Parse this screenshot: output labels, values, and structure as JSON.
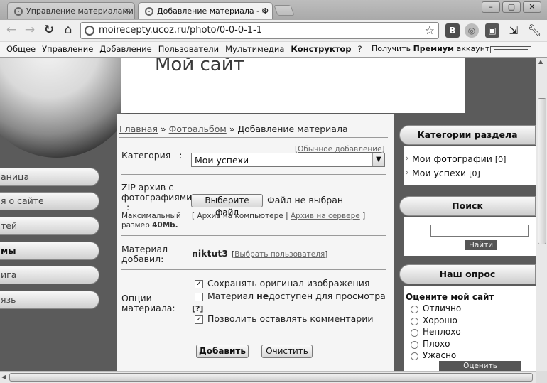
{
  "browser": {
    "tabs": [
      {
        "label": "Управление материалами"
      },
      {
        "label": "Добавление материала - Ф"
      }
    ],
    "tab_close_glyph": "×",
    "window_buttons": [
      "–",
      "▢",
      "✕"
    ],
    "url": "moirecepty.ucoz.ru/photo/0-0-0-1-1",
    "extensions": {
      "vk": "B"
    }
  },
  "adminbar": {
    "menu": [
      "Общее",
      "Управление",
      "Добавление",
      "Пользователи",
      "Мультимедиа",
      "Конструктор",
      "?"
    ],
    "premium_prefix": "Получить",
    "premium_bold": "Премиум",
    "premium_suffix": "аккаунт"
  },
  "site": {
    "title": "Мой сайт"
  },
  "left_nav": [
    "аница",
    "я о сайте",
    "тей",
    "мы",
    "ига",
    "язь"
  ],
  "breadcrumb": {
    "home": "Главная",
    "sep": "»",
    "album": "Фотоальбом",
    "current": "Добавление материала"
  },
  "form": {
    "normal_add_link": "Обычное добавление",
    "category_label": "Категория",
    "category_colon": ":",
    "category_value": "Мои успехи",
    "zip_label_1": "ZIP архив с",
    "zip_label_2": "фотографиями",
    "zip_label_3": ":",
    "choose_file_button": "Выберите файл",
    "file_status": "Файл не выбран",
    "max_size_1": "Максимальный",
    "max_size_2": "размер",
    "max_size_value": "40Mb.",
    "archive_on_computer": "Архив на компьютере",
    "archive_on_server": "Архив на сервере",
    "added_by_label_1": "Материал",
    "added_by_label_2": "добавил:",
    "added_by_value": "niktut3",
    "choose_user_link": "Выбрать пользователя",
    "options_label_1": "Опции",
    "options_label_2": "материала:",
    "opt_keep_original": "Сохранять оригинал изображения",
    "opt_unavailable_prefix": "Материал ",
    "opt_unavailable_bold": "не",
    "opt_unavailable_suffix": "доступен для просмотра",
    "opt_help": "[?]",
    "opt_allow_comments": "Позволить оставлять комментарии",
    "check_keep_original": true,
    "check_unavailable": false,
    "check_allow_comments": true,
    "add_button": "Добавить",
    "clear_button": "Очистить"
  },
  "sidebar": {
    "categories_title": "Категории раздела",
    "categories": [
      {
        "label": "Мои фотографии",
        "count": "[0]"
      },
      {
        "label": "Мои успехи",
        "count": "[0]"
      }
    ],
    "search_title": "Поиск",
    "search_button": "Найти",
    "poll_title": "Наш опрос",
    "poll_question": "Оцените мой сайт",
    "poll_options": [
      "Отлично",
      "Хорошо",
      "Неплохо",
      "Плохо",
      "Ужасно"
    ],
    "poll_button": "Оценить"
  }
}
